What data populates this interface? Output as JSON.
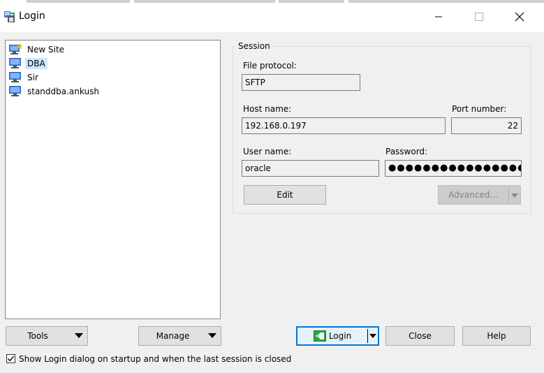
{
  "window": {
    "title": "Login"
  },
  "sites": [
    {
      "label": "New Site",
      "icon": "new-site-icon",
      "selected": false
    },
    {
      "label": "DBA",
      "icon": "computer-icon",
      "selected": true
    },
    {
      "label": "Sir",
      "icon": "computer-icon",
      "selected": false
    },
    {
      "label": "standdba.ankush",
      "icon": "computer-icon",
      "selected": false
    }
  ],
  "session": {
    "legend": "Session",
    "file_protocol_label": "File protocol:",
    "file_protocol_value": "SFTP",
    "host_label": "Host name:",
    "host_value": "192.168.0.197",
    "port_label": "Port number:",
    "port_value": "22",
    "user_label": "User name:",
    "user_value": "oracle",
    "password_label": "Password:",
    "password_mask": "●●●●●●●●●●●●●●●●",
    "edit_label": "Edit",
    "advanced_label": "Advanced..."
  },
  "buttons": {
    "tools": "Tools",
    "manage": "Manage",
    "login": "Login",
    "close": "Close",
    "help": "Help"
  },
  "startup_checkbox": {
    "label": "Show Login dialog on startup and when the last session is closed",
    "checked": true
  },
  "colors": {
    "accent": "#0078d7",
    "selection": "#cce8ff",
    "login_icon_green": "#2fa34a"
  }
}
